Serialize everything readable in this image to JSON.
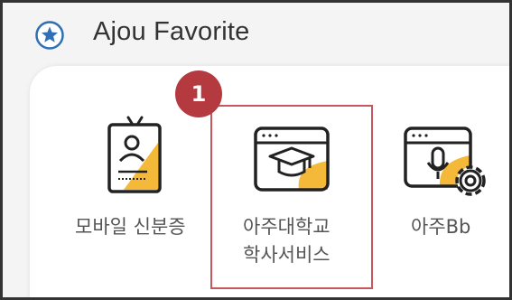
{
  "header": {
    "title": "Ajou Favorite",
    "star_icon": "star-circle-icon"
  },
  "callout": {
    "step_number": "1"
  },
  "apps": [
    {
      "icon": "id-badge-icon",
      "label": "모바일 신분증"
    },
    {
      "icon": "graduation-cap-window-icon",
      "label_line1": "아주대학교",
      "label_line2": "학사서비스"
    },
    {
      "icon": "microphone-gear-window-icon",
      "label": "아주Bb"
    }
  ],
  "colors": {
    "accent_blue": "#2f6fb5",
    "icon_yellow": "#f5b93a",
    "highlight_red": "#c8575d",
    "badge_red": "#b53a40",
    "icon_stroke": "#222222"
  }
}
